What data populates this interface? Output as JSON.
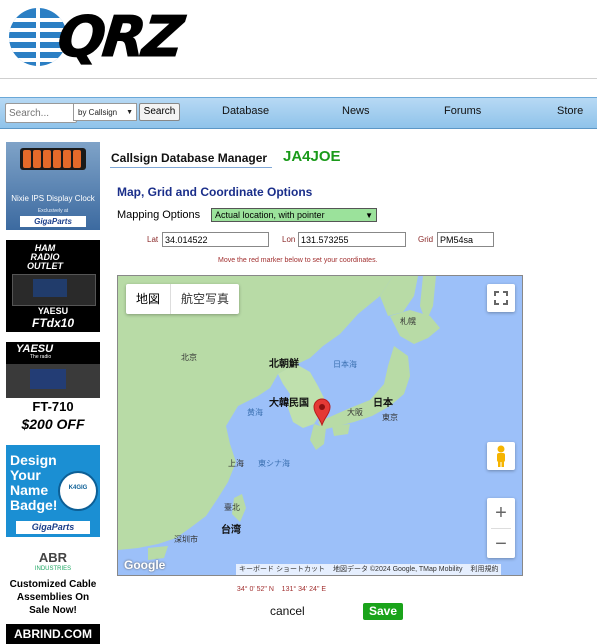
{
  "header": {
    "logo_text": "QRZ"
  },
  "search": {
    "placeholder": "Search...",
    "by_option": "by Callsign",
    "button_label": "Search"
  },
  "nav": {
    "items": [
      {
        "label": "Database"
      },
      {
        "label": "News"
      },
      {
        "label": "Forums"
      },
      {
        "label": "Store"
      }
    ]
  },
  "sidebar_ads": {
    "ad1": {
      "caption": "Nixie IPS Display Clock",
      "small": "Exclusively at",
      "brand": "GigaParts"
    },
    "ad2": {
      "logo": "HAM RADIO OUTLET",
      "maker": "YAESU",
      "model": "FTdx10"
    },
    "ad3": {
      "maker": "YAESU",
      "sub": "The radio",
      "model": "FT-710",
      "price": "$200 OFF"
    },
    "ad4": {
      "text": "Design Your Name Badge!",
      "badge_call": "K4GIG",
      "brand": "GigaParts"
    },
    "ad5": {
      "logo": "ABR",
      "industries": "INDUSTRIES",
      "text": "Customized Cable Assemblies On Sale Now!",
      "url": "ABRIND.COM"
    }
  },
  "page": {
    "title": "Callsign Database Manager",
    "callsign": "JA4JOE",
    "section_title": "Map, Grid and Coordinate Options",
    "mapping_label": "Mapping Options",
    "mapping_value": "Actual location, with pointer",
    "lat_label": "Lat",
    "lat_value": "34.014522",
    "lon_label": "Lon",
    "lon_value": "131.573255",
    "grid_label": "Grid",
    "grid_value": "PM54sa",
    "instruction": "Move the red marker below to set your coordinates.",
    "coord_readout": "34° 0' 52\" N    131° 34' 24\" E",
    "cancel_label": "cancel",
    "save_label": "Save"
  },
  "map": {
    "tab_map": "地図",
    "tab_satellite": "航空写真",
    "zoom_in": "+",
    "zoom_out": "−",
    "labels": {
      "sapporo": "札幌",
      "beijing": "北京",
      "north_korea": "北朝鮮",
      "sea_of_japan": "日本海",
      "south_korea": "大韓民国",
      "japan": "日本",
      "osaka": "大阪",
      "tokyo": "東京",
      "yellow_sea": "黄海",
      "shanghai": "上海",
      "east_china_sea": "東シナ海",
      "taipei": "臺北",
      "taiwan": "台湾",
      "shenzhen": "深圳市"
    },
    "google": "Google",
    "attr_shortcuts": "キーボード ショートカット",
    "attr_data": "地図データ ©2024 Google, TMap Mobility",
    "attr_terms": "利用規約"
  },
  "colors": {
    "accent_green": "#1aa31a",
    "callsign_green": "#1a9a1a",
    "nav_blue": "#a6cff0",
    "map_water": "#9cc0f9",
    "map_land": "#b8dba6",
    "marker_red": "#e53935"
  }
}
